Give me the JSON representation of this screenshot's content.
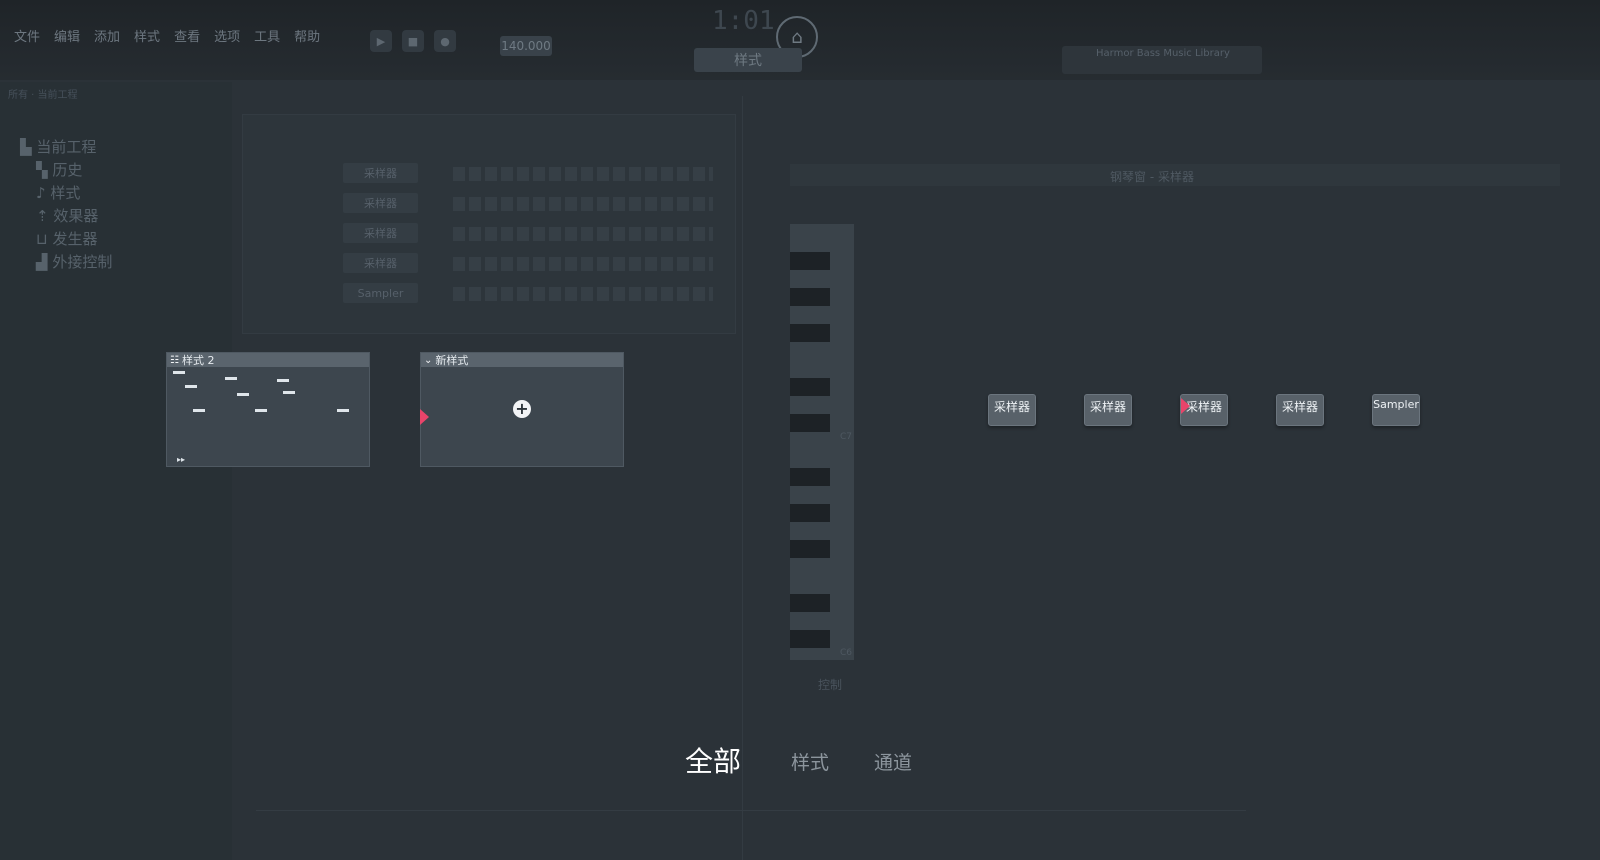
{
  "app": {
    "menu": [
      "文件",
      "编辑",
      "添加",
      "样式",
      "查看",
      "选项",
      "工具",
      "帮助"
    ],
    "tempo": "140.000",
    "timecode": "1:01",
    "mode_label": "样式",
    "news_text": "Harmor Bass Music Library",
    "browser_path": "所有 · 当前工程",
    "browser_tree": {
      "root": "当前工程",
      "items": [
        "历史",
        "样式",
        "效果器",
        "发生器",
        "外接控制"
      ]
    },
    "channel_rack_rows": [
      "采样器",
      "采样器",
      "采样器",
      "采样器",
      "Sampler"
    ],
    "piano_roll_title": "钢琴窗 - 采样器",
    "key_labels": [
      "C7",
      "C6"
    ],
    "control_label": "控制"
  },
  "patterns": [
    {
      "title": "样式 2",
      "icon": "pattern-icon"
    },
    {
      "title": "新样式",
      "icon": "chevron-down-icon"
    }
  ],
  "channels": [
    "采样器",
    "采样器",
    "采样器",
    "采样器",
    "Sampler"
  ],
  "filter_tabs": {
    "all": "全部",
    "patterns": "样式",
    "channels": "通道",
    "active": "all"
  },
  "colors": {
    "accent_flag": "#e8446a",
    "card_bg": "#3d464e",
    "card_title": "#5a646d",
    "channel_button": "#586169"
  }
}
